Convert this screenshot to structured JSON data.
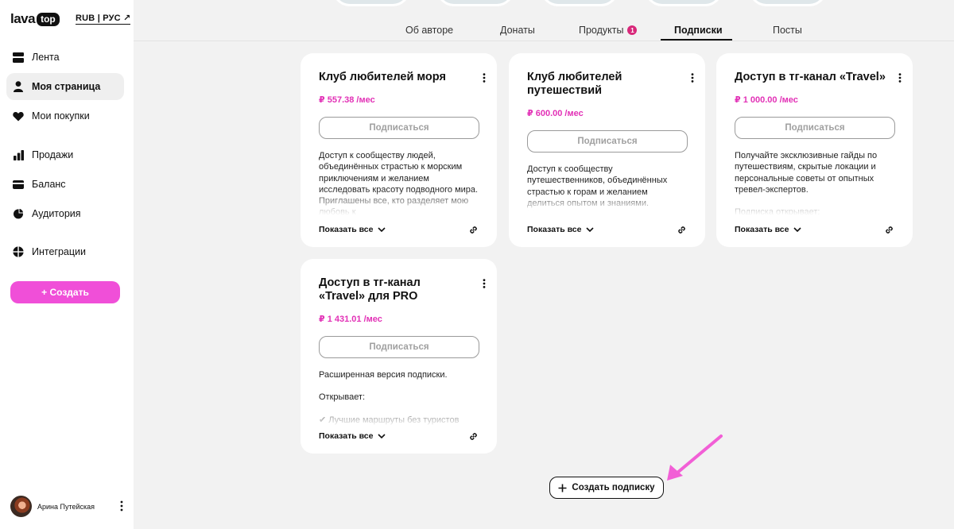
{
  "brand": {
    "logo_text": "lava",
    "logo_badge": "top"
  },
  "currency_switch": "RUB | РУС ↗",
  "sidebar": {
    "items": [
      {
        "label": "Лента",
        "icon": "feed-icon"
      },
      {
        "label": "Моя страница",
        "icon": "user-icon",
        "active": true
      },
      {
        "label": "Мои покупки",
        "icon": "heart-icon"
      },
      {
        "label": "Продажи",
        "icon": "bar-chart-icon"
      },
      {
        "label": "Баланс",
        "icon": "card-icon"
      },
      {
        "label": "Аудитория",
        "icon": "pie-chart-icon"
      },
      {
        "label": "Интеграции",
        "icon": "integrations-icon"
      }
    ],
    "create_label": "+ Создать"
  },
  "user": {
    "name": "Арина Путейская"
  },
  "tabs": [
    {
      "label": "Об авторе"
    },
    {
      "label": "Донаты"
    },
    {
      "label": "Продукты",
      "badge": "1"
    },
    {
      "label": "Подписки",
      "active": true
    },
    {
      "label": "Посты"
    }
  ],
  "cards": [
    {
      "title": "Клуб любителей моря",
      "price": "₽ 557.38 /мес",
      "button": "Подписаться",
      "description": [
        "Доступ к сообществу людей, объединённых страстью к морским приключениям и желанием исследовать красоту подводного мира. Приглашены все, кто разделяет мою любовь к"
      ],
      "show_all": "Показать все"
    },
    {
      "title": "Клуб любителей путешествий",
      "price": "₽ 600.00 /мес",
      "button": "Подписаться",
      "description": [
        "Доступ к сообществу путешественников, объединённых страстью к горам и желанием делиться опытом и знаниями. Множество полезных"
      ],
      "show_all": "Показать все"
    },
    {
      "title": "Доступ в тг-канал «Travel»",
      "price": "₽ 1 000.00 /мес",
      "button": "Подписаться",
      "description": [
        "Получайте эксклюзивные гайды по путешествиям, скрытые локации и персональные советы от опытных тревел-экспертов.",
        "Подписка открывает:"
      ],
      "show_all": "Показать все"
    },
    {
      "title": "Доступ в тг-канал «Travel» для PRO",
      "price": "₽ 1 431.01 /мес",
      "button": "Подписаться",
      "description": [
        "Расширенная версия подписки.",
        "Открывает:",
        "✔ Лучшие маршруты без туристов"
      ],
      "show_all": "Показать все"
    }
  ],
  "new_subscription_label": "Создать подписку",
  "colors": {
    "accent": "#f04fd8",
    "price": "#e231b6",
    "badge": "#d8287a",
    "annotation_arrow": "#f25fd6"
  }
}
